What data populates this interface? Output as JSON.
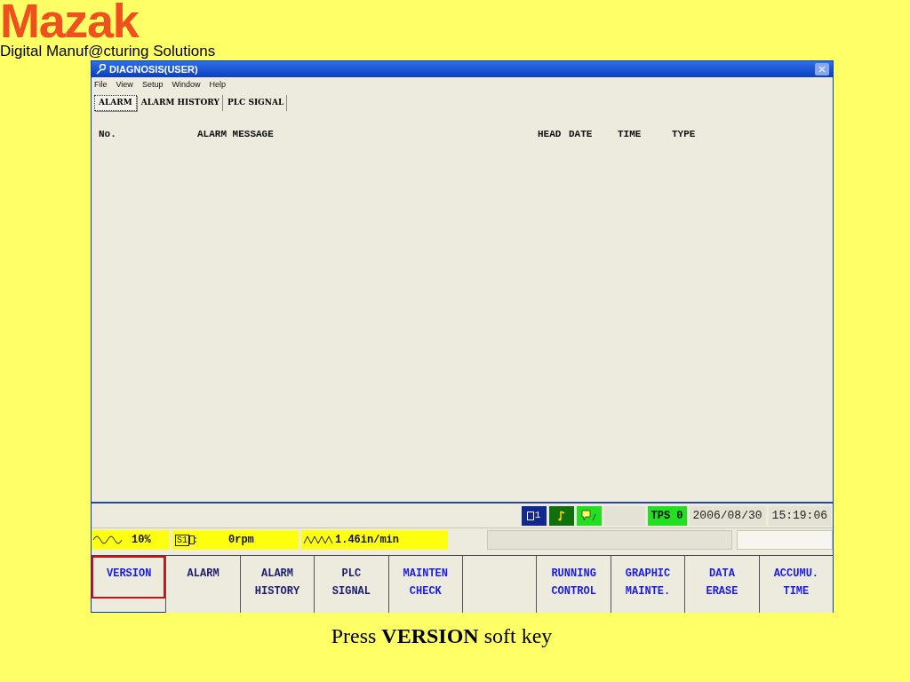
{
  "logo": "Mazak",
  "tagline": "Digital Manuf@cturing Solutions",
  "window": {
    "title": "DIAGNOSIS(USER)"
  },
  "menu": [
    "File",
    "View",
    "Setup",
    "Window",
    "Help"
  ],
  "tabs": [
    {
      "label": "ALARM",
      "selected": true
    },
    {
      "label": "ALARM HISTORY",
      "selected": false
    },
    {
      "label": "PLC SIGNAL",
      "selected": false
    }
  ],
  "table": {
    "columns": [
      "No.",
      "ALARM MESSAGE",
      "HEAD",
      "DATE",
      "TIME",
      "TYPE"
    ]
  },
  "status_bar": {
    "monitor_badge": "1",
    "tps": "TPS 0",
    "date": "2006/08/30",
    "time": "15:19:06"
  },
  "info_bar": {
    "override": "10%",
    "spindle_label": "S1",
    "spindle_speed": "0rpm",
    "feed": "1.46in/min"
  },
  "soft_keys": [
    {
      "lines": [
        "VERSION"
      ],
      "color": "#1a1ae6",
      "highlighted": true
    },
    {
      "lines": [
        "ALARM"
      ],
      "color": "#1c1c6e",
      "highlighted": false
    },
    {
      "lines": [
        "ALARM",
        "HISTORY"
      ],
      "color": "#1c1c6e",
      "highlighted": false
    },
    {
      "lines": [
        "PLC",
        "SIGNAL"
      ],
      "color": "#1c1c6e",
      "highlighted": false
    },
    {
      "lines": [
        "MAINTEN",
        "CHECK"
      ],
      "color": "#1a1ae6",
      "highlighted": false
    },
    {
      "kind": "blank"
    },
    {
      "lines": [
        "RUNNING",
        "CONTROL"
      ],
      "color": "#1a1ae6",
      "highlighted": false
    },
    {
      "lines": [
        "GRAPHIC",
        "MAINTE."
      ],
      "color": "#1a1ae6",
      "highlighted": false
    },
    {
      "lines": [
        "DATA",
        "ERASE"
      ],
      "color": "#1a1ae6",
      "highlighted": false
    },
    {
      "lines": [
        "ACCUMU.",
        "TIME"
      ],
      "color": "#1a1ae6",
      "highlighted": false
    }
  ],
  "caption": "Press **VERSION** soft key"
}
